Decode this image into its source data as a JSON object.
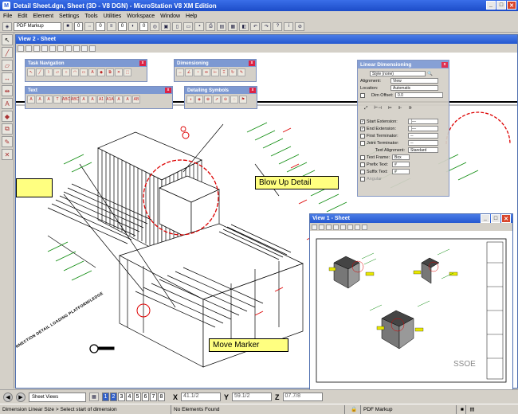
{
  "window": {
    "title": "Detail Sheet.dgn, Sheet (3D - V8 DGN) - MicroStation V8 XM Edition"
  },
  "menu": [
    "File",
    "Edit",
    "Element",
    "Settings",
    "Tools",
    "Utilities",
    "Workspace",
    "Window",
    "Help"
  ],
  "toolbar": {
    "level": "PDF Markup",
    "color": "0",
    "style": "0",
    "weight": "0",
    "class": "0"
  },
  "view2": {
    "title": "View 2 - Sheet"
  },
  "view1": {
    "title": "View 1 - Sheet"
  },
  "palettes": {
    "task_navigation": "Task Navigation",
    "dimensioning": "Dimensioning",
    "text": "Text",
    "detailing_symbols": "Detailing Symbols"
  },
  "linear_dim": {
    "title": "Linear Dimensioning",
    "style": "Style (none)",
    "alignment_label": "Alignment:",
    "alignment_value": "View",
    "location_label": "Location:",
    "location_value": "Automatic",
    "offset_label": "Dim Offset:",
    "offset_value": "0.0",
    "start_ext": "Start Extension:",
    "end_ext": "End Extension:",
    "first_term": "First Terminator:",
    "joint_term": "Joint Terminator:",
    "text_align_label": "Text Alignment:",
    "text_align_value": "Standard",
    "text_frame_label": "Text Frame:",
    "text_frame_value": "Box",
    "prefix_label": "Prefix Text:",
    "prefix_value": "#",
    "suffix_label": "Suffix Text:",
    "suffix_value": "#",
    "angular": "Angular"
  },
  "callouts": {
    "blowup": "Blow Up Detail",
    "move": "Move Marker"
  },
  "drawing_label": "CONNECTION DETAIL LOADING PLATFORM/LEDGE",
  "bottom": {
    "view_group": "Sheet Views",
    "pages": [
      "1",
      "2",
      "3",
      "4",
      "5",
      "6",
      "7",
      "8"
    ],
    "x_label": "X",
    "x_value": "41.1/2",
    "y_label": "Y",
    "y_value": "59.1/2",
    "z_label": "Z",
    "z_value": "07.7/8"
  },
  "status": {
    "prompt": "Dimension Linear Size > Select start of dimension",
    "elements": "No Elements Found",
    "level": "PDF Markup"
  }
}
